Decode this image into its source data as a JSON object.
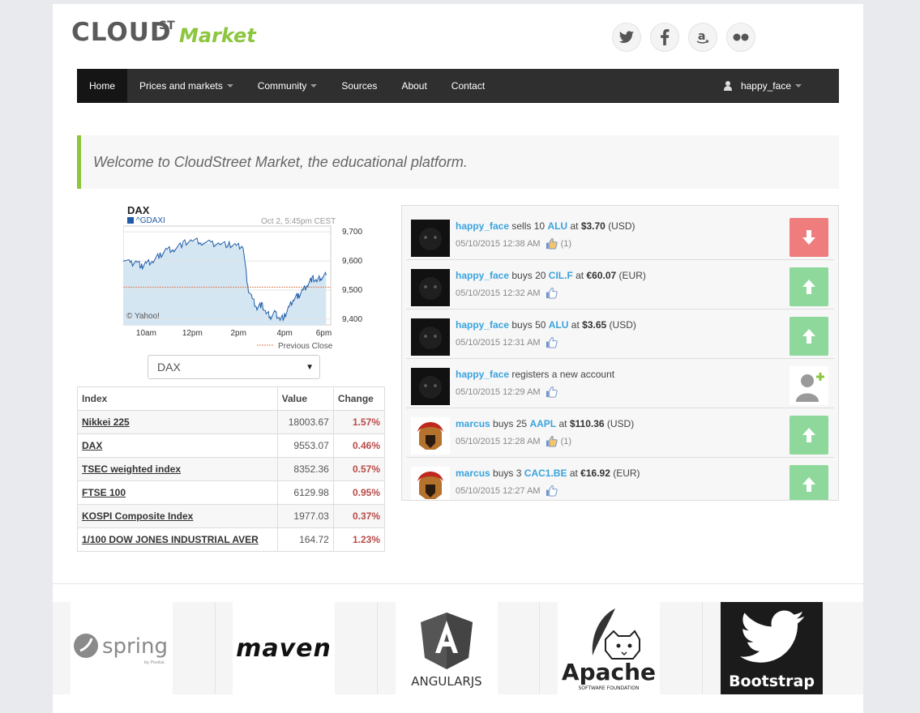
{
  "brand": {
    "cloud": "CLOUD",
    "st": "ST",
    "market": "Market"
  },
  "social": [
    "twitter-icon",
    "facebook-icon",
    "amazon-icon",
    "flickr-icon"
  ],
  "nav": {
    "items": [
      {
        "label": "Home",
        "active": true,
        "dropdown": false
      },
      {
        "label": "Prices and markets",
        "dropdown": true
      },
      {
        "label": "Community",
        "dropdown": true
      },
      {
        "label": "Sources",
        "dropdown": false
      },
      {
        "label": "About",
        "dropdown": false
      },
      {
        "label": "Contact",
        "dropdown": false
      }
    ],
    "user": "happy_face"
  },
  "welcome": "Welcome to CloudStreet Market, the educational platform.",
  "chart_data": {
    "type": "line",
    "title": "DAX",
    "symbol": "^GDAXI",
    "date": "Oct 2, 5:45pm CEST",
    "credit": "© Yahoo!",
    "legend": "Previous Close",
    "previous_close": 9510,
    "ylim": [
      9380,
      9720
    ],
    "yticks": [
      "9,700",
      "9,600",
      "9,500",
      "9,400"
    ],
    "ytick_values": [
      9700,
      9600,
      9500,
      9400
    ],
    "xticks": [
      "10am",
      "12pm",
      "2pm",
      "4pm",
      "6pm"
    ],
    "xtick_hours": [
      10,
      12,
      14,
      16,
      17.7
    ],
    "xlim": [
      9,
      18
    ],
    "x": [
      9.0,
      9.3,
      9.6,
      9.8,
      10.0,
      10.3,
      10.6,
      10.9,
      11.2,
      11.6,
      12.0,
      12.4,
      12.8,
      13.2,
      13.6,
      13.9,
      14.2,
      14.4,
      14.6,
      14.8,
      15.0,
      15.2,
      15.4,
      15.6,
      15.8,
      16.0,
      16.2,
      16.4,
      16.6,
      16.8,
      17.0,
      17.2,
      17.4,
      17.6,
      17.8
    ],
    "y": [
      9610,
      9590,
      9600,
      9580,
      9590,
      9600,
      9620,
      9640,
      9640,
      9660,
      9670,
      9665,
      9660,
      9660,
      9655,
      9650,
      9650,
      9510,
      9470,
      9440,
      9450,
      9420,
      9410,
      9420,
      9400,
      9410,
      9440,
      9470,
      9480,
      9500,
      9520,
      9540,
      9530,
      9545,
      9550
    ]
  },
  "selector": {
    "value": "DAX"
  },
  "indices": {
    "headers": [
      "Index",
      "Value",
      "Change"
    ],
    "rows": [
      {
        "name": "Nikkei 225",
        "value": "18003.67",
        "change": "1.57%"
      },
      {
        "name": "DAX",
        "value": "9553.07",
        "change": "0.46%"
      },
      {
        "name": "TSEC weighted index",
        "value": "8352.36",
        "change": "0.57%"
      },
      {
        "name": "FTSE 100",
        "value": "6129.98",
        "change": "0.95%"
      },
      {
        "name": "KOSPI Composite Index",
        "value": "1977.03",
        "change": "0.37%"
      },
      {
        "name": "1/100 DOW JONES INDUSTRIAL AVER",
        "value": "164.72",
        "change": "1.23%"
      }
    ]
  },
  "feed": [
    {
      "user": "happy_face",
      "verb": "sells",
      "qty": "10",
      "ticker": "ALU",
      "at": "at",
      "price": "$3.70",
      "cur": "(USD)",
      "time": "05/10/2015 12:38 AM",
      "likes": "(1)",
      "action": "down",
      "avatar": "cat"
    },
    {
      "user": "happy_face",
      "verb": "buys",
      "qty": "20",
      "ticker": "CIL.F",
      "at": "at",
      "price": "€60.07",
      "cur": "(EUR)",
      "time": "05/10/2015 12:32 AM",
      "likes": "",
      "action": "up",
      "avatar": "cat"
    },
    {
      "user": "happy_face",
      "verb": "buys",
      "qty": "50",
      "ticker": "ALU",
      "at": "at",
      "price": "$3.65",
      "cur": "(USD)",
      "time": "05/10/2015 12:31 AM",
      "likes": "",
      "action": "up",
      "avatar": "cat"
    },
    {
      "user": "happy_face",
      "verb": "registers a new account",
      "qty": "",
      "ticker": "",
      "at": "",
      "price": "",
      "cur": "",
      "time": "05/10/2015 12:29 AM",
      "likes": "",
      "action": "user",
      "avatar": "cat"
    },
    {
      "user": "marcus",
      "verb": "buys",
      "qty": "25",
      "ticker": "AAPL",
      "at": "at",
      "price": "$110.36",
      "cur": "(USD)",
      "time": "05/10/2015 12:28 AM",
      "likes": "(1)",
      "action": "up",
      "avatar": "spartan"
    },
    {
      "user": "marcus",
      "verb": "buys",
      "qty": "3",
      "ticker": "CAC1.BE",
      "at": "at",
      "price": "€16.92",
      "cur": "(EUR)",
      "time": "05/10/2015 12:27 AM",
      "likes": "",
      "action": "up",
      "avatar": "spartan"
    }
  ],
  "sponsors": {
    "spring": "spring",
    "spring_sub": "by Pivotal.",
    "maven": "maven",
    "angular": "ANGULARJS",
    "apache": "Apache",
    "apache_sub": "SOFTWARE FOUNDATION",
    "bootstrap": "Bootstrap"
  },
  "colors": {
    "accent_green": "#8cc63f",
    "link_blue": "#3aa3de",
    "change_red": "#b94a48",
    "sell_red": "#f07d7d",
    "buy_green": "#8fd89c",
    "navbar": "#2f2f2f"
  }
}
